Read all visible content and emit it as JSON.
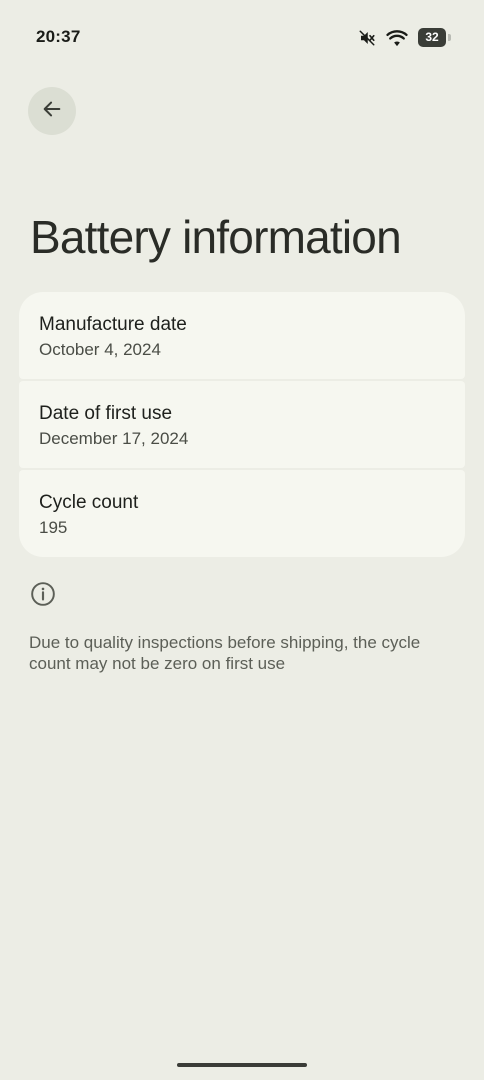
{
  "status_bar": {
    "time": "20:37",
    "battery_level": "32",
    "icons": [
      "mute-icon",
      "wifi-icon",
      "battery-icon"
    ]
  },
  "header": {
    "back_icon": "arrow-back-icon",
    "title": "Battery information"
  },
  "details": [
    {
      "label": "Manufacture date",
      "value": "October 4, 2024"
    },
    {
      "label": "Date of first use",
      "value": "December 17, 2024"
    },
    {
      "label": "Cycle count",
      "value": "195"
    }
  ],
  "info": {
    "icon": "info-icon",
    "text": "Due to quality inspections before shipping, the cycle count may not be zero on first use"
  },
  "colors": {
    "background": "#ecede5",
    "card": "#f6f7f0",
    "back_button_bg": "#dbded3"
  }
}
